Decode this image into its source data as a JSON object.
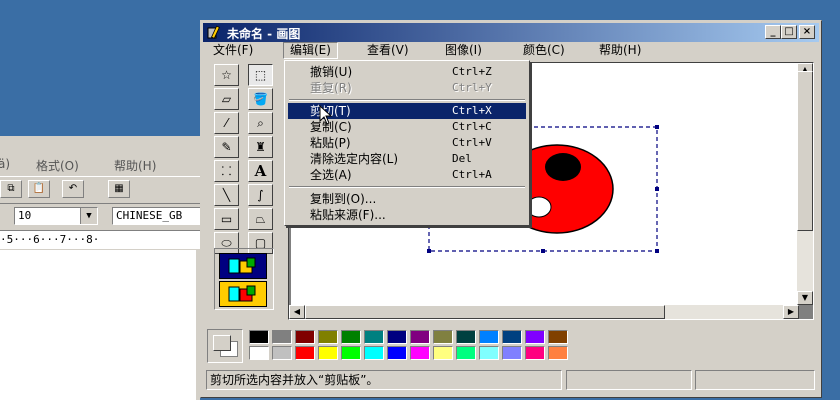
{
  "wordpad": {
    "menu": [
      "ä)",
      "格式(O)",
      "帮助(H)"
    ],
    "font_size": "10",
    "script": "CHINESE_GB",
    "ruler": "·5···6···7···8·",
    "icons": [
      "copy-icon",
      "paste-icon",
      "undo-icon",
      "date-time-icon"
    ]
  },
  "paint": {
    "title": "未命名 - 画图",
    "caption_buttons": [
      "_",
      "□",
      "×"
    ],
    "menu": [
      "文件(F)",
      "编辑(E)",
      "查看(V)",
      "图像(I)",
      "颜色(C)",
      "帮助(H)"
    ],
    "tools": [
      "free-form-select",
      "rectangle-select",
      "eraser",
      "fill",
      "pick-color",
      "magnifier",
      "pencil",
      "brush",
      "airbrush",
      "text",
      "line",
      "curve",
      "rectangle",
      "polygon",
      "ellipse",
      "rounded-rectangle"
    ],
    "text_tool_label": "A",
    "status": "剪切所选内容并放入“剪贴板”。",
    "palette": [
      "#000000",
      "#808080",
      "#800000",
      "#808000",
      "#008000",
      "#008080",
      "#000080",
      "#800080",
      "#808040",
      "#004040",
      "#0080ff",
      "#004080",
      "#8000ff",
      "#804000",
      "#ffffff",
      "#c0c0c0",
      "#ff0000",
      "#ffff00",
      "#00ff00",
      "#00ffff",
      "#0000ff",
      "#ff00ff",
      "#ffff80",
      "#00ff80",
      "#80ffff",
      "#8080ff",
      "#ff0080",
      "#ff8040"
    ]
  },
  "edit_menu": {
    "items": [
      {
        "label": "撤销(U)",
        "shortcut": "Ctrl+Z",
        "state": "normal"
      },
      {
        "label": "重复(R)",
        "shortcut": "Ctrl+Y",
        "state": "disabled"
      },
      {
        "label": "剪切(T)",
        "shortcut": "Ctrl+X",
        "state": "highlighted"
      },
      {
        "label": "复制(C)",
        "shortcut": "Ctrl+C",
        "state": "normal"
      },
      {
        "label": "粘贴(P)",
        "shortcut": "Ctrl+V",
        "state": "normal"
      },
      {
        "label": "清除选定内容(L)",
        "shortcut": "Del",
        "state": "normal"
      },
      {
        "label": "全选(A)",
        "shortcut": "Ctrl+A",
        "state": "normal"
      },
      {
        "label": "复制到(O)...",
        "shortcut": "",
        "state": "normal"
      },
      {
        "label": "粘贴来源(F)...",
        "shortcut": "",
        "state": "normal"
      }
    ]
  },
  "colors": {
    "title_start": "#0a246a",
    "title_end": "#a6caf0",
    "desktop": "#3a6ea5",
    "menu_highlight": "#0a246a",
    "drawing_red": "#ff0000"
  }
}
